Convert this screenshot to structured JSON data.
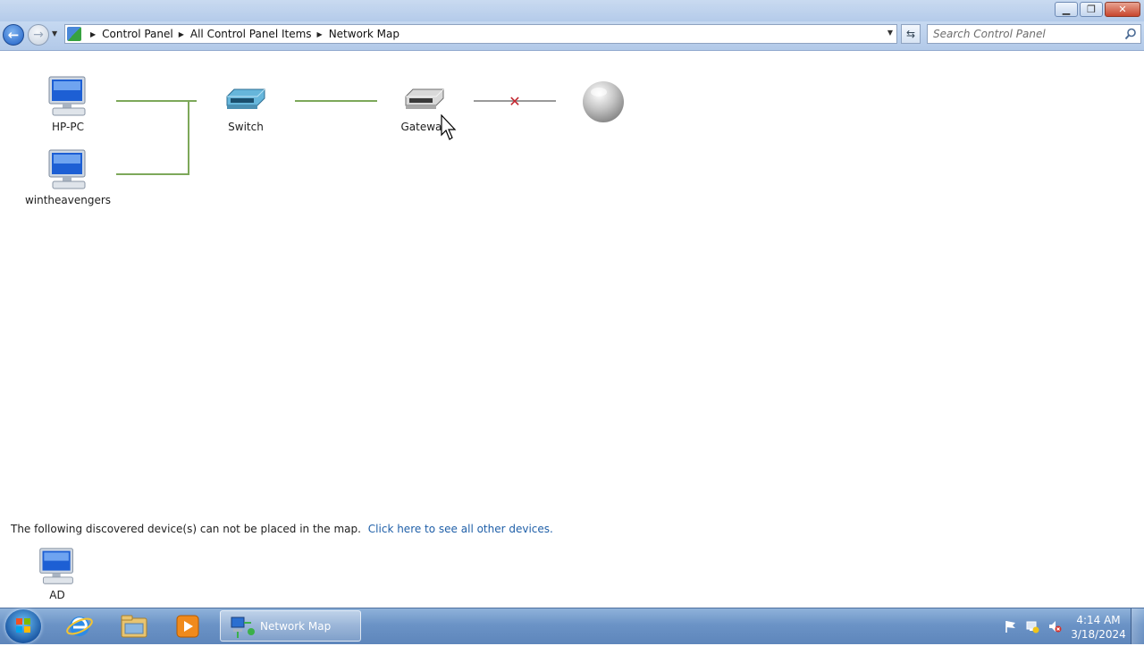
{
  "window": {
    "minimize_glyph": "▁",
    "restore_glyph": "❐",
    "close_glyph": "✕"
  },
  "address_bar": {
    "breadcrumbs": [
      "Control Panel",
      "All Control Panel Items",
      "Network Map"
    ],
    "search_placeholder": "Search Control Panel"
  },
  "network_map": {
    "devices": [
      {
        "id": "hp-pc",
        "label": "HP-PC",
        "icon": "computer-icon"
      },
      {
        "id": "wintheavengers",
        "label": "wintheavengers",
        "icon": "computer-icon"
      },
      {
        "id": "switch",
        "label": "Switch",
        "icon": "switch-icon"
      },
      {
        "id": "gateway",
        "label": "Gateway",
        "icon": "gateway-icon"
      },
      {
        "id": "internet",
        "label": "",
        "icon": "internet-globe-icon"
      }
    ],
    "gateway_to_internet_status": "disconnected"
  },
  "unplaced": {
    "message": "The following discovered device(s) can not be placed in the map.",
    "link": "Click here to see all other devices.",
    "devices": [
      {
        "label": "AD",
        "icon": "computer-icon"
      }
    ]
  },
  "taskbar": {
    "active_window_label": "Network Map",
    "pinned": [
      "internet-explorer-icon",
      "windows-explorer-icon",
      "media-player-icon"
    ],
    "tray_icons": [
      "action-center-flag-icon",
      "network-icon",
      "volume-muted-icon"
    ],
    "time": "4:14 AM",
    "date": "3/18/2024"
  },
  "colors": {
    "link": "#1f5fa8",
    "connection_line": "#7da85a",
    "broken_link_x": "#c2242d"
  }
}
